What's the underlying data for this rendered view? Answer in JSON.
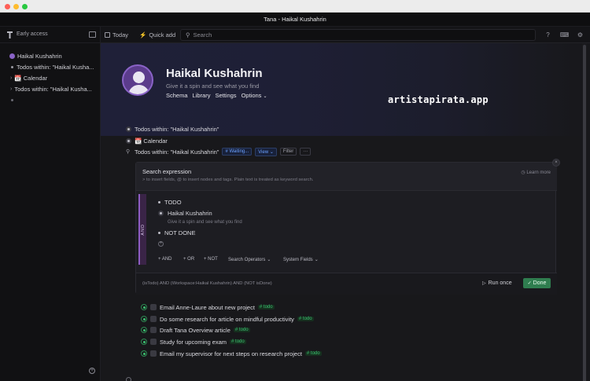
{
  "window": {
    "title": "Tana - Haikal Kushahrin"
  },
  "colors": {
    "close": "#fe5f57",
    "minimize": "#febc2e",
    "zoom": "#28c840",
    "accent_purple": "#8e5cc4",
    "done_green": "#2f7d4f",
    "tag_green": "#3bbf70"
  },
  "sidebar": {
    "header": "Early access",
    "items": [
      {
        "label": "Haikal Kushahrin",
        "icon": "avatar-icon"
      },
      {
        "label": "Todos within: \"Haikal Kusha...",
        "icon": "bullet-icon"
      },
      {
        "label": "📆 Calendar",
        "icon": "chevron-right-icon"
      },
      {
        "label": "Todos within: \"Haikal Kusha...",
        "icon": "chevron-right-icon"
      },
      {
        "label": "",
        "icon": "bullet-icon"
      }
    ]
  },
  "toolbar": {
    "today": "Today",
    "quick_add": "Quick add",
    "search_placeholder": "Search"
  },
  "page": {
    "title": "Haikal Kushahrin",
    "subtitle": "Give it a spin and see what you find",
    "links": [
      "Schema",
      "Library",
      "Settings",
      "Options"
    ]
  },
  "watermark": "artistapirata.app",
  "nodes": {
    "todos_within": "Todos within: \"Haikal Kushahrin\"",
    "calendar": "📆 Calendar",
    "search_node": "Todos within: \"Haikal Kushahrin\"",
    "chip_waiting": "# Waiting...",
    "chip_view": "View",
    "chip_filter": "Filter",
    "chip_more": "···"
  },
  "search_panel": {
    "title": "Search expression",
    "hint": "> to insert fields, @ to insert nodes and tags. Plain text is treated as keyword search.",
    "learn_more": "Learn more",
    "and_label": "AND",
    "expressions": [
      {
        "label": "TODO",
        "sub": ""
      },
      {
        "label": "Haikal Kushahrin",
        "sub": "Give it a spin and see what you find"
      },
      {
        "label": "NOT DONE",
        "sub": ""
      }
    ],
    "buttons": [
      "+ AND",
      "+ OR",
      "+ NOT",
      "Search Operators",
      "System Fields"
    ],
    "query": "(isTodo) AND (Workspace:Haikal Kushahrin) AND (NOT isDone)",
    "run_once": "Run once",
    "done": "Done"
  },
  "todos": [
    {
      "text": "Email Anne-Laure about new project",
      "tag": "# todo"
    },
    {
      "text": "Do some research for article on mindful productivity",
      "tag": "# todo"
    },
    {
      "text": "Draft Tana Overview article",
      "tag": "# todo"
    },
    {
      "text": "Study for upcoming exam",
      "tag": "# todo"
    },
    {
      "text": "Email my supervisor for next steps on research project",
      "tag": "# todo"
    }
  ]
}
